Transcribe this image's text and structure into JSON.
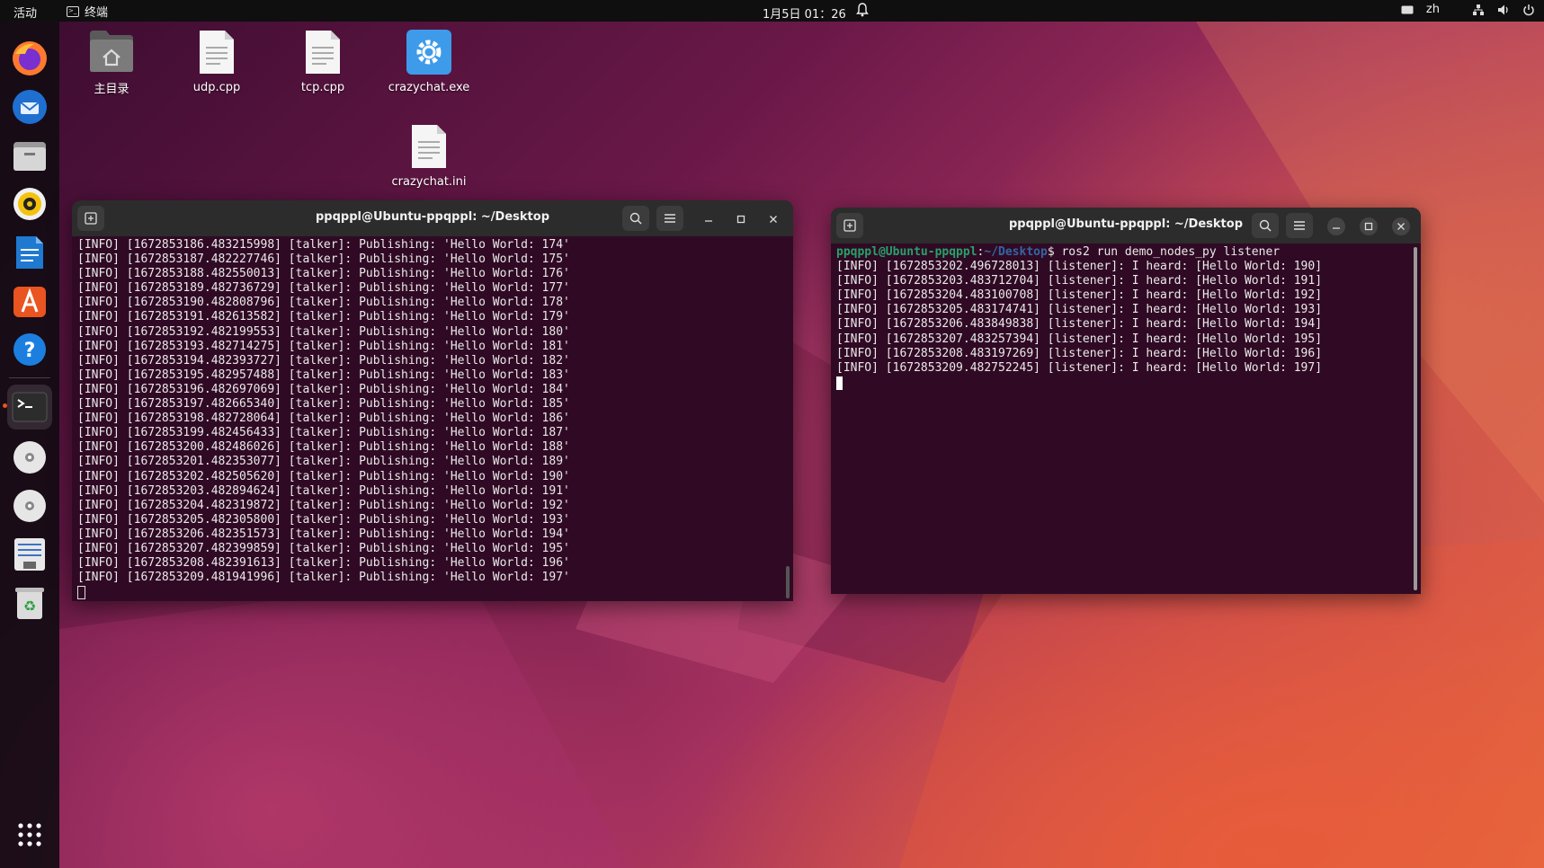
{
  "topbar": {
    "activities": "活动",
    "app_name": "终端",
    "clock": "1月5日 01：26",
    "input_method": "zh"
  },
  "dock": {
    "items": [
      "firefox-icon",
      "thunderbird-icon",
      "files-icon",
      "rhythmbox-icon",
      "libreoffice-writer-icon",
      "app-center-icon",
      "help-icon",
      "terminal-icon",
      "disc-icon",
      "disc-icon",
      "text-editor-icon",
      "trash-icon",
      "app-grid-icon"
    ]
  },
  "desktop": {
    "icons": [
      {
        "label": "主目录",
        "icon": "home-folder-icon"
      },
      {
        "label": "udp.cpp",
        "icon": "text-file-icon"
      },
      {
        "label": "tcp.cpp",
        "icon": "text-file-icon"
      },
      {
        "label": "crazychat.exe",
        "icon": "gear-exe-icon"
      },
      {
        "label": "crazychat.ini",
        "icon": "text-file-icon"
      }
    ]
  },
  "terminal_left": {
    "title": "ppqppl@Ubuntu-ppqppl: ~/Desktop",
    "lines": [
      "[INFO] [1672853186.483215998] [talker]: Publishing: 'Hello World: 174'",
      "[INFO] [1672853187.482227746] [talker]: Publishing: 'Hello World: 175'",
      "[INFO] [1672853188.482550013] [talker]: Publishing: 'Hello World: 176'",
      "[INFO] [1672853189.482736729] [talker]: Publishing: 'Hello World: 177'",
      "[INFO] [1672853190.482808796] [talker]: Publishing: 'Hello World: 178'",
      "[INFO] [1672853191.482613582] [talker]: Publishing: 'Hello World: 179'",
      "[INFO] [1672853192.482199553] [talker]: Publishing: 'Hello World: 180'",
      "[INFO] [1672853193.482714275] [talker]: Publishing: 'Hello World: 181'",
      "[INFO] [1672853194.482393727] [talker]: Publishing: 'Hello World: 182'",
      "[INFO] [1672853195.482957488] [talker]: Publishing: 'Hello World: 183'",
      "[INFO] [1672853196.482697069] [talker]: Publishing: 'Hello World: 184'",
      "[INFO] [1672853197.482665340] [talker]: Publishing: 'Hello World: 185'",
      "[INFO] [1672853198.482728064] [talker]: Publishing: 'Hello World: 186'",
      "[INFO] [1672853199.482456433] [talker]: Publishing: 'Hello World: 187'",
      "[INFO] [1672853200.482486026] [talker]: Publishing: 'Hello World: 188'",
      "[INFO] [1672853201.482353077] [talker]: Publishing: 'Hello World: 189'",
      "[INFO] [1672853202.482505620] [talker]: Publishing: 'Hello World: 190'",
      "[INFO] [1672853203.482894624] [talker]: Publishing: 'Hello World: 191'",
      "[INFO] [1672853204.482319872] [talker]: Publishing: 'Hello World: 192'",
      "[INFO] [1672853205.482305800] [talker]: Publishing: 'Hello World: 193'",
      "[INFO] [1672853206.482351573] [talker]: Publishing: 'Hello World: 194'",
      "[INFO] [1672853207.482399859] [talker]: Publishing: 'Hello World: 195'",
      "[INFO] [1672853208.482391613] [talker]: Publishing: 'Hello World: 196'",
      "[INFO] [1672853209.481941996] [talker]: Publishing: 'Hello World: 197'"
    ]
  },
  "terminal_right": {
    "title": "ppqppl@Ubuntu-ppqppl: ~/Desktop",
    "prompt_user": "ppqppl@Ubuntu-ppqppl",
    "prompt_sep": ":",
    "prompt_path": "~/Desktop",
    "command": "$ ros2 run demo_nodes_py listener",
    "lines": [
      "[INFO] [1672853202.496728013] [listener]: I heard: [Hello World: 190]",
      "[INFO] [1672853203.483712704] [listener]: I heard: [Hello World: 191]",
      "[INFO] [1672853204.483100708] [listener]: I heard: [Hello World: 192]",
      "[INFO] [1672853205.483174741] [listener]: I heard: [Hello World: 193]",
      "[INFO] [1672853206.483849838] [listener]: I heard: [Hello World: 194]",
      "[INFO] [1672853207.483257394] [listener]: I heard: [Hello World: 195]",
      "[INFO] [1672853208.483197269] [listener]: I heard: [Hello World: 196]",
      "[INFO] [1672853209.482752245] [listener]: I heard: [Hello World: 197]"
    ]
  },
  "colors": {
    "terminal_bg": "#300a24",
    "header_bg": "#2c2c2c",
    "prompt_user": "#26a269",
    "prompt_path": "#3465a4",
    "ubuntu_orange": "#e95420"
  }
}
